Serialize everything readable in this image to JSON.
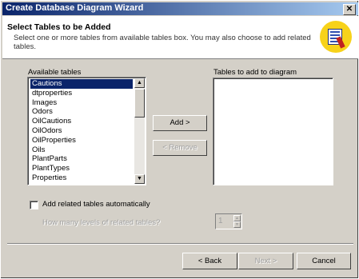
{
  "window": {
    "title": "Create Database Diagram Wizard",
    "close_glyph": "✕"
  },
  "header": {
    "title": "Select Tables to be Added",
    "description": "Select one or more tables from available tables box. You may also choose to add related tables.",
    "icon": "database-diagram-wizard-icon"
  },
  "available": {
    "label": "Available tables",
    "items": [
      "Cautions",
      "dtproperties",
      "Images",
      "Odors",
      "OilCautions",
      "OilOdors",
      "OilProperties",
      "Oils",
      "PlantParts",
      "PlantTypes",
      "Properties"
    ],
    "selected": "Cautions"
  },
  "add_list": {
    "label": "Tables to add to diagram",
    "items": []
  },
  "buttons": {
    "add": "Add >",
    "remove": "< Remove",
    "back": "< Back",
    "next": "Next >",
    "cancel": "Cancel"
  },
  "related": {
    "checkbox_label": "Add related tables automatically",
    "checked": false,
    "levels_label": "How many levels of related tables?",
    "levels_value": "1"
  },
  "scroll": {
    "up_glyph": "▲",
    "down_glyph": "▼"
  },
  "colors": {
    "title_start": "#0a246a",
    "title_end": "#a6caf0",
    "selection": "#0a246a",
    "face": "#d4d0c8",
    "icon_bg": "#f7d21a"
  }
}
